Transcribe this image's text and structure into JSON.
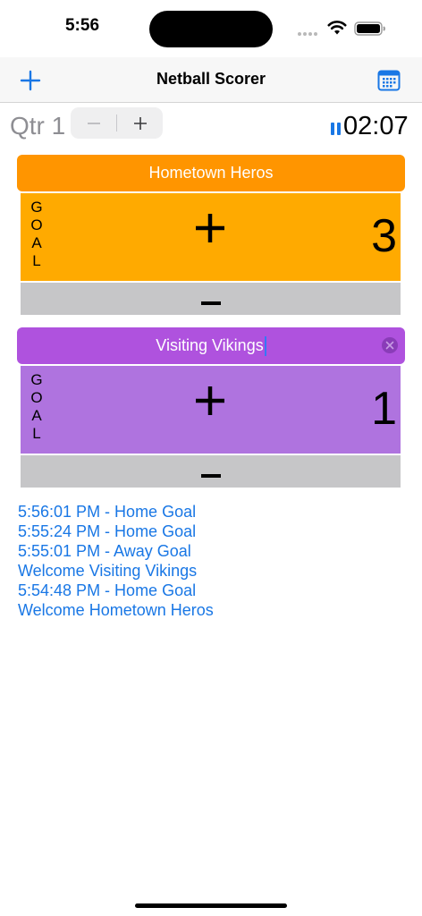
{
  "status_bar": {
    "time": "5:56",
    "icons": [
      "cellular-dots-icon",
      "wifi-icon",
      "battery-icon"
    ]
  },
  "nav": {
    "title": "Netball Scorer",
    "left_icon": "plus-icon",
    "right_icon": "calendar-icon",
    "accent_color": "#1977e5"
  },
  "quarter": {
    "label": "Qtr 1",
    "stepper_minus": "−",
    "stepper_plus": "+"
  },
  "timer": {
    "value": "02:07",
    "state_icon": "pause-icon"
  },
  "home": {
    "name": "Hometown Heros",
    "goal_letters": [
      "G",
      "O",
      "A",
      "L"
    ],
    "score": "3",
    "header_color": "#ff9500",
    "panel_color": "#ffaa00"
  },
  "away": {
    "name": "Visiting Vikings",
    "goal_letters": [
      "G",
      "O",
      "A",
      "L"
    ],
    "score": "1",
    "header_color": "#af52de",
    "panel_color": "#af73df"
  },
  "log": [
    "5:56:01 PM - Home Goal",
    "5:55:24 PM - Home Goal",
    "5:55:01 PM - Away Goal",
    "Welcome Visiting Vikings",
    "5:54:48 PM - Home Goal",
    "Welcome Hometown Heros"
  ]
}
